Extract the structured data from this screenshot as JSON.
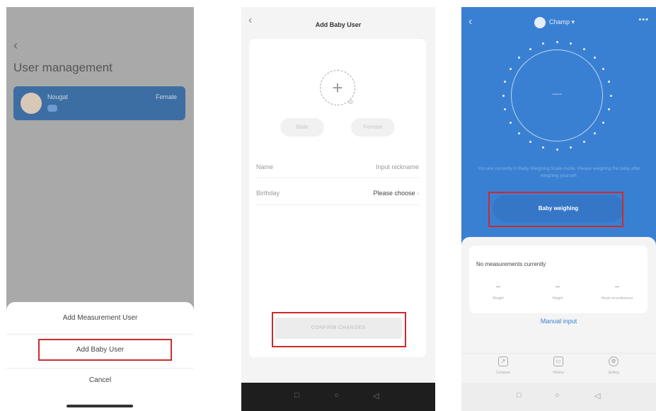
{
  "screen1": {
    "back_glyph": "‹",
    "title": "User management",
    "user_card": {
      "name": "Nougat",
      "gender": "Female"
    },
    "sheet": {
      "items": [
        "Add Measurement User",
        "Add Baby User",
        "Cancel"
      ]
    },
    "highlight_color": "#cc2b2b",
    "overlay_color": "#a9a9a9"
  },
  "screen2": {
    "back_glyph": "‹",
    "title": "Add Baby User",
    "add_photo_glyph": "+",
    "gender_buttons": [
      "Male",
      "Female"
    ],
    "fields": [
      {
        "label": "Name",
        "value": "Input nickname"
      },
      {
        "label": "Birthday",
        "value": "Please choose",
        "chevron": "›"
      }
    ],
    "confirm_label": "CONFIRM CHANGES",
    "nav_icons": [
      "□",
      "○",
      "◁"
    ]
  },
  "screen3": {
    "back_glyph": "‹",
    "user_name": "Champ ▾",
    "more_glyph": "•••",
    "weight_display": "----",
    "notice": "You are currently in Baby Weighing Scale mode. Please weighing the baby after weighing yourself.",
    "baby_button": "Baby weighing",
    "no_measurements": "No measurements currently",
    "metrics": [
      {
        "value": "--",
        "label": "Weight"
      },
      {
        "value": "--",
        "label": "Height"
      },
      {
        "value": "--",
        "label": "Head circumference"
      }
    ],
    "manual_input": "Manual input",
    "tabs": [
      {
        "icon": "edit-icon",
        "glyph": "↗",
        "label": "Compare"
      },
      {
        "icon": "calendar-icon",
        "glyph": "▭",
        "label": "History"
      },
      {
        "icon": "settings-icon",
        "glyph": "⚙",
        "label": "Setting"
      }
    ],
    "nav_icons": [
      "□",
      "○",
      "◁"
    ],
    "brand_blue": "#3a80d2"
  }
}
